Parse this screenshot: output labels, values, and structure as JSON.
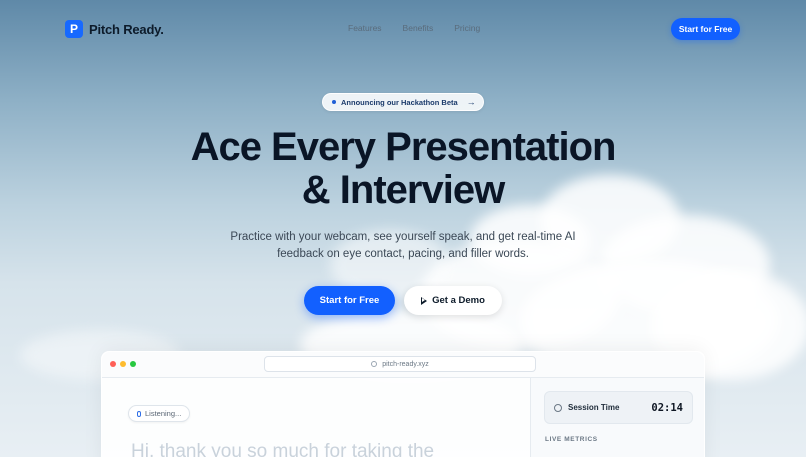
{
  "brand": {
    "logo_letter": "P",
    "name": "Pitch Ready."
  },
  "nav": {
    "links": [
      "Features",
      "Benefits",
      "Pricing"
    ],
    "cta": "Start for Free"
  },
  "announcement": {
    "text": "Announcing our Hackathon Beta",
    "arrow": "→"
  },
  "hero": {
    "title_line1": "Ace Every Presentation",
    "title_line2": "& Interview",
    "subtitle": "Practice with your webcam, see yourself speak, and get real-time AI feedback on eye contact, pacing, and filler words.",
    "primary_cta": "Start for Free",
    "secondary_cta": "Get a Demo"
  },
  "app_window": {
    "url": "pitch-ready.xyz",
    "status": "Listening...",
    "transcript": "Hi, thank you so much for taking the",
    "session_label": "Session Time",
    "session_time": "02:14",
    "metrics_label": "LIVE METRICS"
  },
  "colors": {
    "accent": "#1260ff",
    "dot_red": "#ff5f57",
    "dot_yellow": "#febc2e",
    "dot_green": "#28c840"
  }
}
